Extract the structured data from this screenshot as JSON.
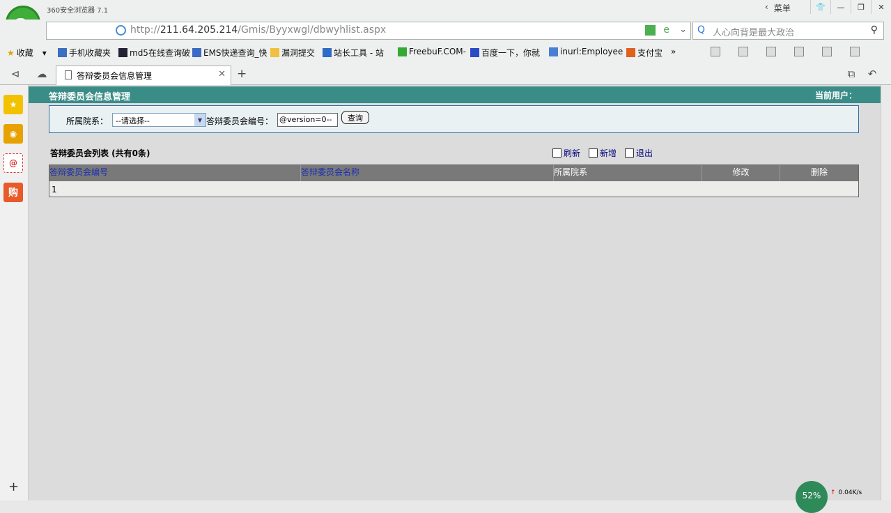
{
  "browser": {
    "app_title": "360安全浏览器 7.1",
    "menu_label": "菜单",
    "url_host": "211.64.205.214",
    "url_prefix": "http://",
    "url_path": "/Gmis/Byyxwgl/dbwyhlist.aspx",
    "search_placeholder": "人心向背是最大政治",
    "bookmarks": [
      "收藏",
      "手机收藏夹",
      "md5在线查询破",
      "EMS快递查询_快",
      "漏洞提交",
      "站长工具 - 站",
      "FreebuF.COM-",
      "百度一下，你就",
      "inurl:Employee",
      "支付宝"
    ],
    "tab_label": "答辩委员会信息管理"
  },
  "page": {
    "title": "答辩委员会信息管理",
    "current_user_label": "当前用户：",
    "filter": {
      "dept_label": "所属院系：",
      "dept_value": "--请选择--",
      "code_label": "答辩委员会编号：",
      "code_value": "@version=0--",
      "query_button": "查询"
    },
    "list_title": "答辩委员会列表 (共有0条)",
    "actions": {
      "refresh": "刷新",
      "add": "新增",
      "exit": "退出"
    },
    "table": {
      "headers": [
        "答辩委员会编号",
        "答辩委员会名称",
        "所属院系",
        "修改",
        "删除"
      ],
      "rows": [
        [
          "1"
        ]
      ]
    }
  },
  "status": {
    "speed_percent": "52%",
    "net_speed": "0.04K/s"
  }
}
